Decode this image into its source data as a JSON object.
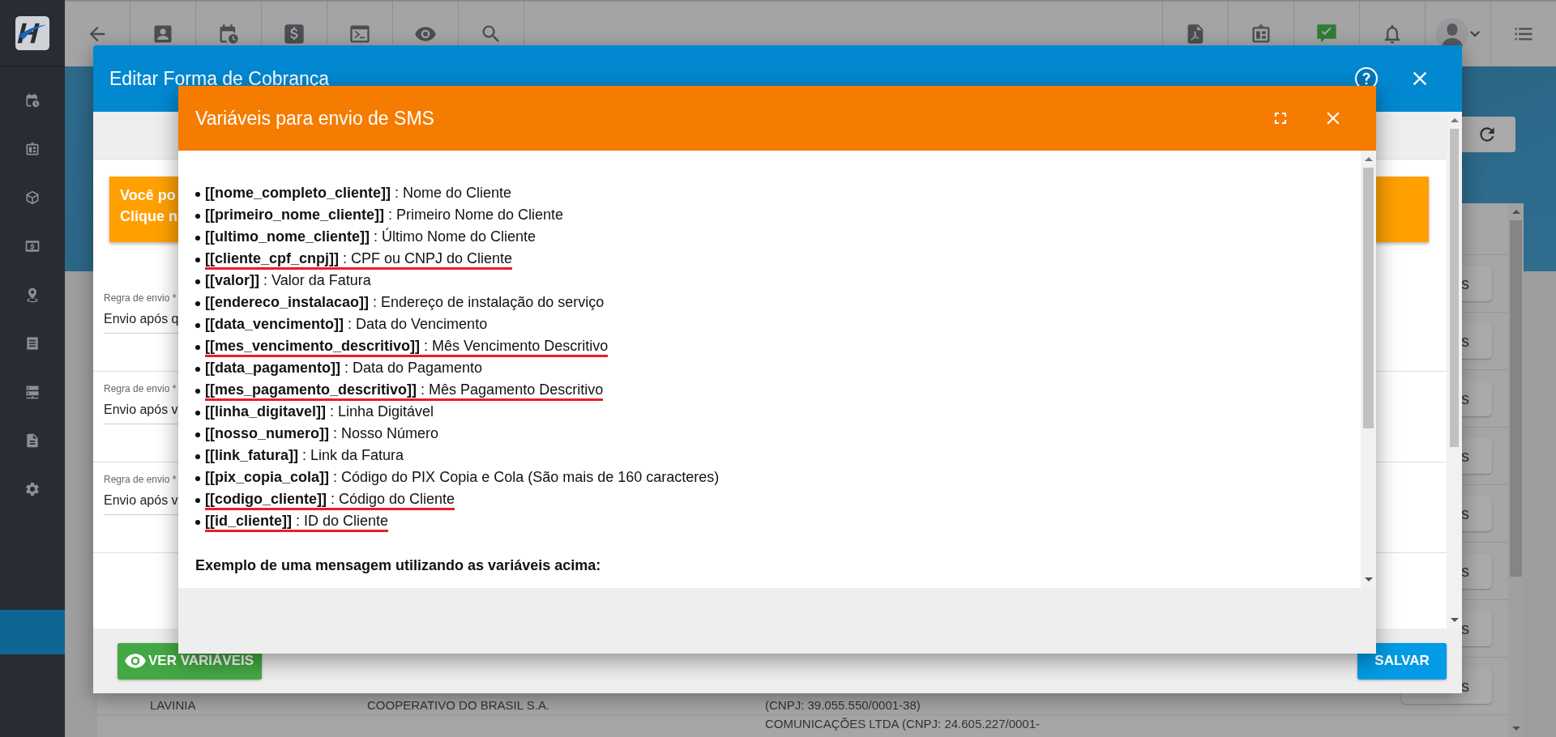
{
  "sidebar": {
    "items": [
      {
        "selected": false
      },
      {
        "selected": false
      },
      {
        "selected": false
      },
      {
        "selected": false
      },
      {
        "selected": false
      },
      {
        "selected": false
      },
      {
        "selected": false
      },
      {
        "selected": false
      },
      {
        "selected": false
      },
      {
        "selected": true
      }
    ]
  },
  "table": {
    "rows": [
      {
        "action": "s"
      },
      {
        "action": "s"
      },
      {
        "action": "s"
      },
      {
        "action": "s"
      },
      {
        "action": "s"
      },
      {
        "action": "s"
      },
      {
        "action": "s"
      },
      {
        "column_1": "LAVINIA",
        "column_2": "COOPERATIVO DO BRASIL S.A.",
        "column_3": "(CNPJ: 39.055.550/0001-38)",
        "action": "s"
      },
      {
        "column_3": "COMUNICAÇÕES LTDA (CNPJ: 24.605.227/0001-"
      }
    ]
  },
  "edit_dialog": {
    "title": "Editar Forma de Cobrança",
    "notice": [
      "Você po",
      "Clique n"
    ],
    "fields": [
      {
        "label": "Regra de envio *",
        "value": "Envio após q"
      },
      {
        "label": "Regra de envio *",
        "value": "Envio após v"
      },
      {
        "label": "Regra de envio *",
        "value": "Envio após v"
      }
    ],
    "buttons": [
      {
        "label": "VER VARIÁVEIS",
        "kind": "secondary"
      },
      {
        "label": "SALVAR",
        "kind": "primary"
      }
    ]
  },
  "sms_dialog": {
    "title": "Variáveis para envio de SMS",
    "items": [
      {
        "text": "**[[nome_completo_cliente]]** : Nome do Cliente",
        "underlined": false
      },
      {
        "text": "**[[primeiro_nome_cliente]]** : Primeiro Nome do Cliente",
        "underlined": false
      },
      {
        "text": "**[[ultimo_nome_cliente]]** : Último Nome do Cliente",
        "underlined": false
      },
      {
        "text": "**[[cliente_cpf_cnpj]]** : CPF ou CNPJ do Cliente",
        "underlined": true
      },
      {
        "text": "**[[valor]]** : Valor da Fatura",
        "underlined": false
      },
      {
        "text": "**[[endereco_instalacao]]** : Endereço de instalação do serviço",
        "underlined": false
      },
      {
        "text": "**[[data_vencimento]]** : Data do Vencimento",
        "underlined": false
      },
      {
        "text": "**[[mes_vencimento_descritivo]]** : Mês Vencimento Descritivo",
        "underlined": true
      },
      {
        "text": "**[[data_pagamento]]** : Data do Pagamento",
        "underlined": false
      },
      {
        "text": "**[[mes_pagamento_descritivo]]** : Mês Pagamento Descritivo",
        "underlined": true
      },
      {
        "text": "**[[linha_digitavel]]** : Linha Digitável",
        "underlined": false
      },
      {
        "text": "**[[nosso_numero]]** : Nosso Número",
        "underlined": false
      },
      {
        "text": "**[[link_fatura]]** : Link da Fatura",
        "underlined": false
      },
      {
        "text": "**[[pix_copia_cola]]** : Código do PIX Copia e Cola (São mais de 160 caracteres)",
        "underlined": false
      },
      {
        "text": "**[[codigo_cliente]]** : Código do Cliente",
        "underlined": true
      },
      {
        "text": "**[[id_cliente]]** : ID do Cliente",
        "underlined": true
      }
    ],
    "example_heading": "Exemplo de uma mensagem utilizando as variáveis acima:"
  }
}
